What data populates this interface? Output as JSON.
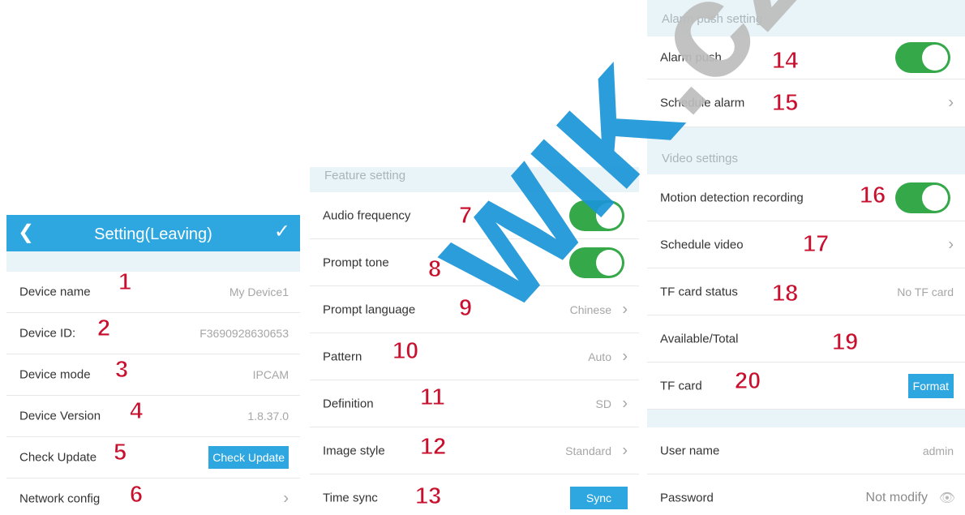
{
  "panel1": {
    "header": {
      "back_icon": "chevron-left-icon",
      "title": "Setting(Leaving)",
      "confirm_icon": "check-icon"
    },
    "rows": [
      {
        "label": "Device name",
        "value": "My Device1"
      },
      {
        "label": "Device ID:",
        "value": "F3690928630653"
      },
      {
        "label": "Device mode",
        "value": "IPCAM"
      },
      {
        "label": "Device Version",
        "value": "1.8.37.0"
      },
      {
        "label": "Check Update",
        "button": "Check Update"
      },
      {
        "label": "Network config"
      }
    ]
  },
  "panel2": {
    "section": "Feature setting",
    "rows": [
      {
        "label": "Audio frequency",
        "toggle": true
      },
      {
        "label": "Prompt tone",
        "toggle": true
      },
      {
        "label": "Prompt language",
        "value": "Chinese"
      },
      {
        "label": "Pattern",
        "value": "Auto"
      },
      {
        "label": "Definition",
        "value": "SD"
      },
      {
        "label": "Image style",
        "value": "Standard"
      },
      {
        "label": "Time sync",
        "button": "Sync"
      }
    ]
  },
  "panel3": {
    "section_alarm": "Alarm push setting",
    "alarm_rows": [
      {
        "label": "Alarm push",
        "toggle": true
      },
      {
        "label": "Schedule alarm"
      }
    ],
    "section_video": "Video settings",
    "video_rows": [
      {
        "label": "Motion detection recording",
        "toggle": true
      },
      {
        "label": "Schedule video"
      },
      {
        "label": "TF card status",
        "value": "No TF card"
      },
      {
        "label": "Available/Total",
        "value": ""
      },
      {
        "label": "TF card",
        "button": "Format"
      }
    ],
    "account_rows": [
      {
        "label": "User name",
        "value": "admin"
      },
      {
        "label": "Password",
        "value": "Not modify"
      }
    ]
  },
  "callouts": [
    "1",
    "2",
    "3",
    "4",
    "5",
    "6",
    "7",
    "8",
    "9",
    "10",
    "11",
    "12",
    "13",
    "14",
    "15",
    "16",
    "17",
    "18",
    "19",
    "20"
  ],
  "watermark": {
    "text": "WIK",
    "suffix": ".cz"
  },
  "colors": {
    "header": "#2ea7e0",
    "toggle_on": "#35a84a",
    "section_bg": "#e9f4f9",
    "callout": "#c8102e"
  }
}
